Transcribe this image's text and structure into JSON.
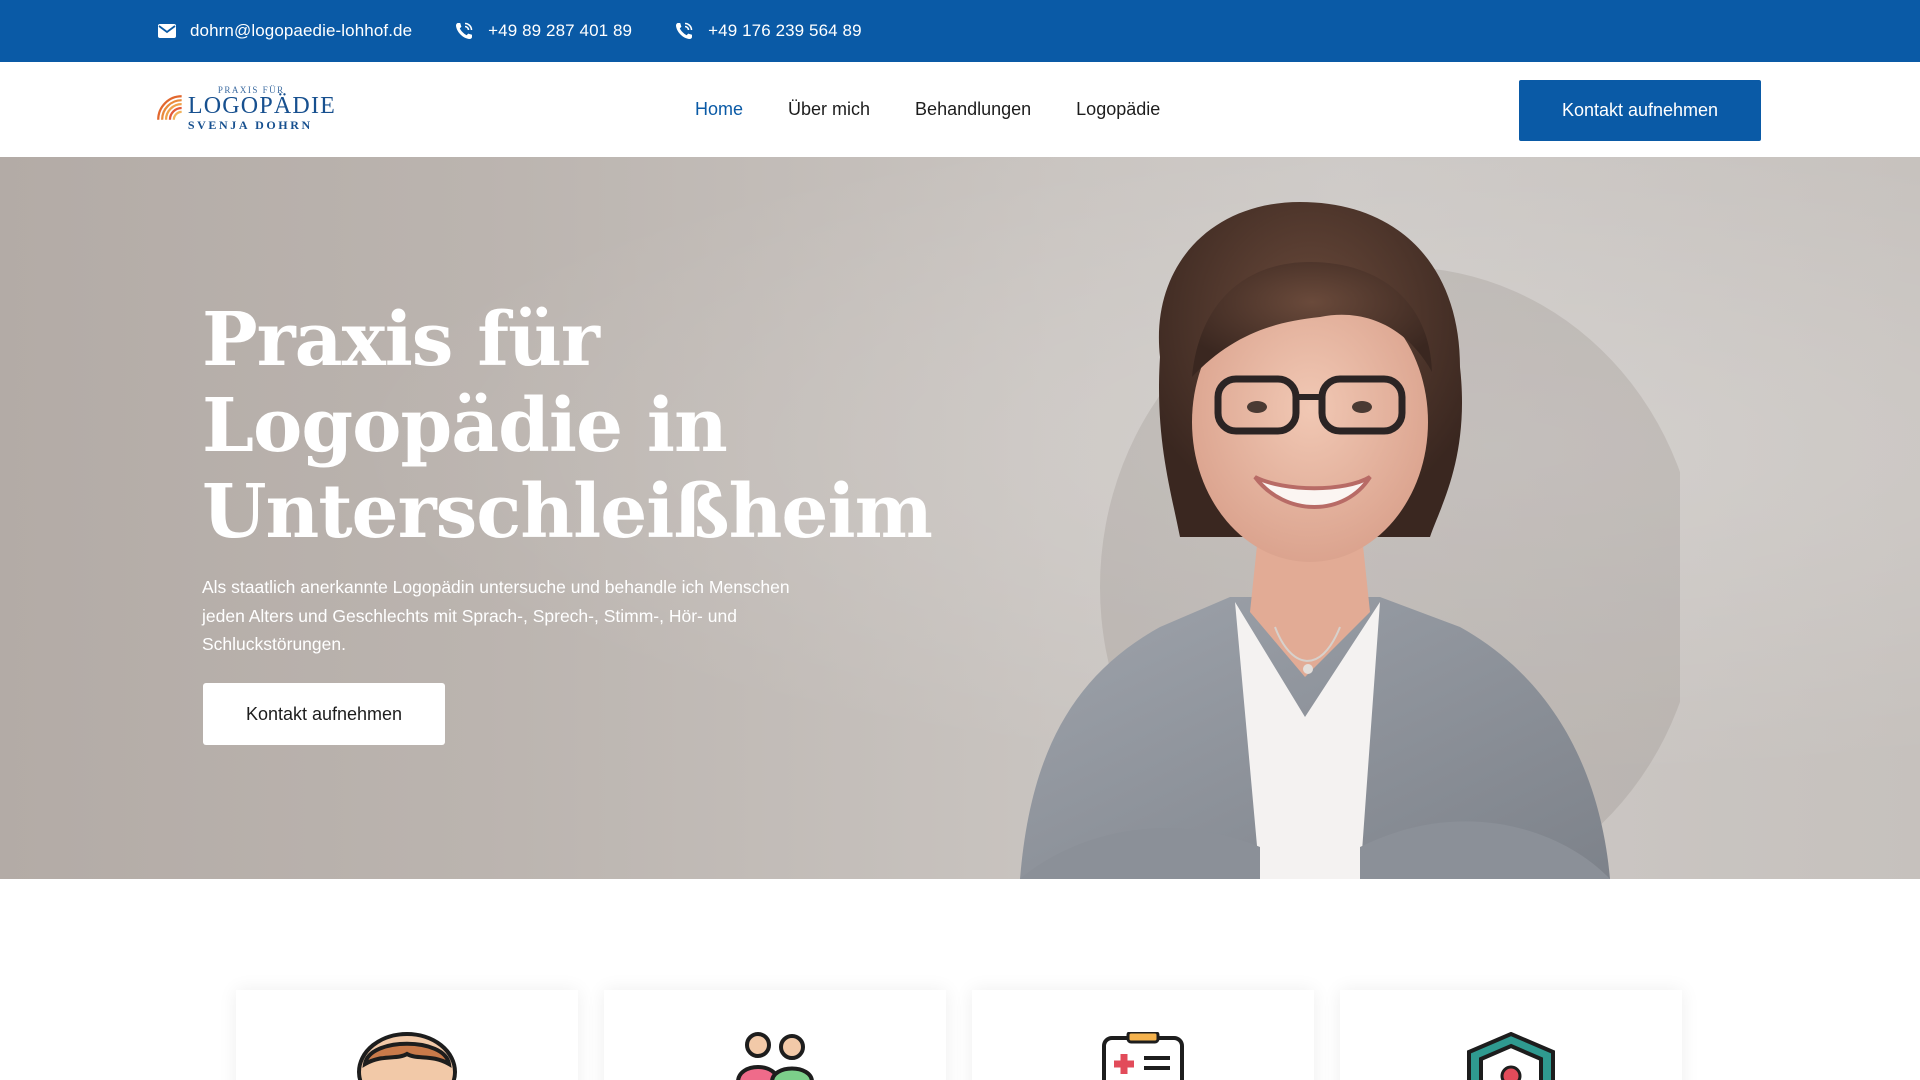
{
  "topbar": {
    "email": "dohrn@logopaedie-lohhof.de",
    "phone1": "+49 89 287 401 89",
    "phone2": "+49 176 239 564 89",
    "icons": [
      "mail-icon",
      "phone-icon",
      "phone-icon"
    ]
  },
  "logo": {
    "line1": "PRAXIS FÜR",
    "line2": "LOGOPÄDIE",
    "line3": "SVENJA DOHRN"
  },
  "nav": {
    "items": [
      {
        "label": "Home",
        "active": true
      },
      {
        "label": "Über mich",
        "active": false
      },
      {
        "label": "Behandlungen",
        "active": false
      },
      {
        "label": "Logopädie",
        "active": false
      }
    ]
  },
  "header": {
    "cta_label": "Kontakt aufnehmen"
  },
  "hero": {
    "title_line1": "Praxis für",
    "title_line2": "Logopädie in",
    "title_line3": "Unterschleißheim",
    "text": "Als staatlich anerkannte Logopädin untersuche und behandle ich Menschen jeden Alters und Geschlechts mit Sprach-, Sprech-, Stimm-, Hör- und Schluckstörungen.",
    "cta_label": "Kontakt aufnehmen"
  },
  "cards": [
    {
      "icon": "child-face-icon"
    },
    {
      "icon": "people-icon"
    },
    {
      "icon": "medical-clipboard-icon"
    },
    {
      "icon": "shield-icon"
    }
  ],
  "colors": {
    "brand_blue": "#0a5aa6",
    "white": "#ffffff"
  }
}
